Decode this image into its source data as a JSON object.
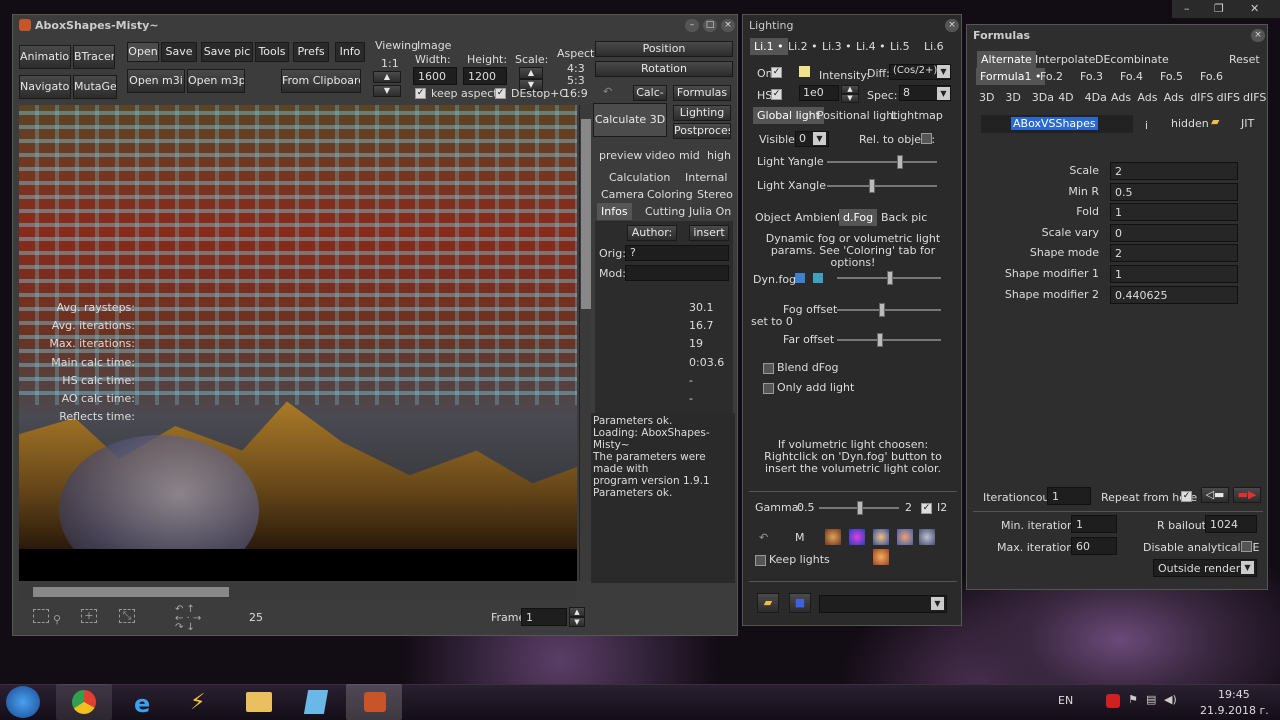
{
  "main_window": {
    "title": "AboxShapes-Misty~",
    "toolbar": {
      "animations": "Animations",
      "btracer": "BTracer",
      "navigator": "Navigator",
      "mutagen": "MutaGen",
      "open": "Open",
      "save": "Save",
      "save_pic": "Save pic",
      "tools": "Tools",
      "prefs": "Prefs",
      "info": "Info",
      "open_m3i": "Open m3i",
      "open_m3p": "Open m3p",
      "from_clipboard": "From Clipboard",
      "viewing": "Viewing",
      "viewing_ratio": "1:1",
      "image": "Image",
      "width_label": "Width:",
      "width": "1600",
      "height_label": "Height:",
      "height": "1200",
      "scale_label": "Scale:",
      "aspect_label": "Aspect:",
      "aspect_values": [
        "4:3",
        "5:3",
        "16:9"
      ],
      "keep_aspect": "keep aspect",
      "destop_c": "DEstop+C"
    },
    "right": {
      "position": "Position",
      "rotation": "Rotation",
      "calc": "Calc-",
      "formulas": "Formulas",
      "calculate_3d": "Calculate 3D",
      "lighting": "Lighting",
      "postprocess": "Postprocess",
      "quality": [
        "preview",
        "video",
        "mid",
        "high"
      ],
      "tabs_row1": [
        "Calculation",
        "Internal"
      ],
      "tabs_row2": [
        "Camera",
        "Coloring",
        "Stereo"
      ],
      "tabs_row3": [
        "Infos",
        "Cutting",
        "Julia On"
      ],
      "author": "Author:",
      "insert": "insert",
      "orig_label": "Orig:",
      "orig_value": "?",
      "mod_label": "Mod:",
      "stats": [
        {
          "label": "Avg. raysteps:",
          "value": "30.1"
        },
        {
          "label": "Avg. iterations:",
          "value": "16.7"
        },
        {
          "label": "Max. iterations:",
          "value": "19"
        },
        {
          "label": "Main calc time:",
          "value": "0:03.6"
        },
        {
          "label": "HS calc time:",
          "value": "-"
        },
        {
          "label": "AO calc time:",
          "value": "-"
        },
        {
          "label": "Reflects time:",
          "value": "-"
        }
      ],
      "log": [
        "Parameters ok.",
        "Loading: AboxShapes-Misty~",
        "The parameters were made with",
        "program version 1.9.1",
        "Parameters ok."
      ]
    },
    "bottom": {
      "step": "25",
      "frame_label": "Frame:",
      "frame": "1"
    }
  },
  "lighting_window": {
    "title": "Lighting",
    "light_tabs": [
      "Li.1 •",
      "Li.2 •",
      "Li.3 •",
      "Li.4 •",
      "Li.5",
      "Li.6"
    ],
    "on": "On",
    "intensity": "Intensity:",
    "diff": "Diff:",
    "diff_value": "(Cos/2+)²",
    "hs": "HS",
    "hs_value": "1e0",
    "spec": "Spec:",
    "spec_value": "8",
    "light_tabs2": [
      "Global light",
      "Positional light",
      "Lightmap"
    ],
    "visible": "Visible:",
    "visible_value": "0",
    "rel_object": "Rel. to object:",
    "yangle": "Light Yangle",
    "xangle": "Light Xangle",
    "sub_tabs": [
      "Object",
      "Ambient",
      "d.Fog",
      "Back pic"
    ],
    "fog_info": "Dynamic fog or volumetric light params. See 'Coloring' tab for options!",
    "dyn_fog": "Dyn.fog",
    "fog_offset": "Fog offset",
    "set_to_0": "set to 0",
    "far_offset": "Far offset",
    "blend_dfog": "Blend dFog",
    "only_add_light": "Only add light",
    "vol_info": "If volumetric light choosen:  Rightclick on 'Dyn.fog' button to insert the volumetric light color.",
    "gamma": "Gamma:",
    "gamma_value": "0.5",
    "gamma_max": "2",
    "i2": "I2",
    "m": "M",
    "keep_lights": "Keep lights"
  },
  "formulas_window": {
    "title": "Formulas",
    "top": [
      "Alternate",
      "Interpolate",
      "DEcombinate"
    ],
    "reset": "Reset",
    "formula_tabs": [
      "Formula1 •",
      "Fo.2",
      "Fo.3",
      "Fo.4",
      "Fo.5",
      "Fo.6"
    ],
    "types": [
      "3D",
      "3D",
      "3Da",
      "4D",
      "4Da",
      "Ads",
      "Ads",
      "Ads",
      "dIFS",
      "dIFS",
      "dIFS"
    ],
    "formula_name": "ABoxVSShapes",
    "i": "i",
    "hidden": "hidden",
    "jit": "JIT",
    "params": [
      {
        "label": "Scale",
        "value": "2"
      },
      {
        "label": "Min R",
        "value": "0.5"
      },
      {
        "label": "Fold",
        "value": "1"
      },
      {
        "label": "Scale vary",
        "value": "0"
      },
      {
        "label": "Shape mode",
        "value": "2"
      },
      {
        "label": "Shape modifier 1",
        "value": "1"
      },
      {
        "label": "Shape modifier 2",
        "value": "0.440625"
      }
    ],
    "iterationcount_label": "Iterationcount",
    "iterationcount": "1",
    "repeat": "Repeat from here",
    "min_iter_label": "Min. iterations:",
    "min_iter": "1",
    "r_bailout_label": "R bailout:",
    "r_bailout": "1024",
    "max_iter_label": "Max. iterations:",
    "max_iter": "60",
    "disable_de": "Disable analytical DE",
    "outside_render": "Outside render"
  },
  "taskbar": {
    "lang": "EN",
    "time": "19:45",
    "date": "21.9.2018 г."
  }
}
